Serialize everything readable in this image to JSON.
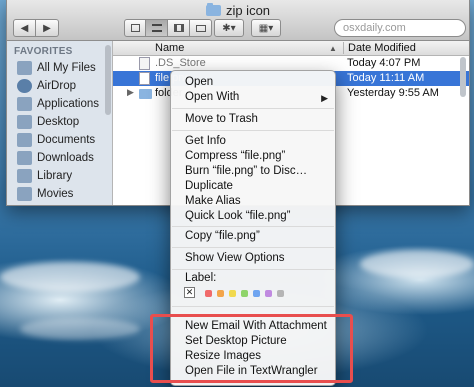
{
  "window": {
    "title": "zip icon",
    "search_placeholder": "osxdaily.com"
  },
  "toolbar": {
    "back_glyph": "◀",
    "forward_glyph": "▶",
    "action_glyph": "✱▾",
    "arrange_glyph": "▦▾"
  },
  "sidebar": {
    "heading": "FAVORITES",
    "items": [
      {
        "label": "All My Files",
        "icon": "all-my-files-icon"
      },
      {
        "label": "AirDrop",
        "icon": "airdrop-icon"
      },
      {
        "label": "Applications",
        "icon": "applications-icon"
      },
      {
        "label": "Desktop",
        "icon": "desktop-icon"
      },
      {
        "label": "Documents",
        "icon": "documents-icon"
      },
      {
        "label": "Downloads",
        "icon": "downloads-icon"
      },
      {
        "label": "Library",
        "icon": "library-icon"
      },
      {
        "label": "Movies",
        "icon": "movies-icon"
      }
    ]
  },
  "list": {
    "col_name": "Name",
    "col_date": "Date Modified",
    "rows": [
      {
        "name": ".DS_Store",
        "date": "Today 4:07 PM"
      },
      {
        "name": "file.png",
        "date": "Today 11:11 AM"
      },
      {
        "name": "folder",
        "date": "Yesterday 9:55 AM"
      }
    ]
  },
  "menu": {
    "open": "Open",
    "open_with": "Open With",
    "move_to_trash": "Move to Trash",
    "get_info": "Get Info",
    "compress": "Compress “file.png”",
    "burn": "Burn “file.png” to Disc…",
    "duplicate": "Duplicate",
    "make_alias": "Make Alias",
    "quick_look": "Quick Look “file.png”",
    "copy": "Copy “file.png”",
    "show_view_options": "Show View Options",
    "label_title": "Label:",
    "label_colors": [
      "#f06a6a",
      "#f3a54a",
      "#f1d94e",
      "#8fd46a",
      "#6fa5f0",
      "#c08ae0",
      "#b5b5b5"
    ],
    "services": [
      "New Email With Attachment",
      "Set Desktop Picture",
      "Resize Images",
      "Open File in TextWrangler"
    ]
  },
  "colors": {
    "selection": "#3875d7",
    "highlight_box": "#e84e4e"
  }
}
